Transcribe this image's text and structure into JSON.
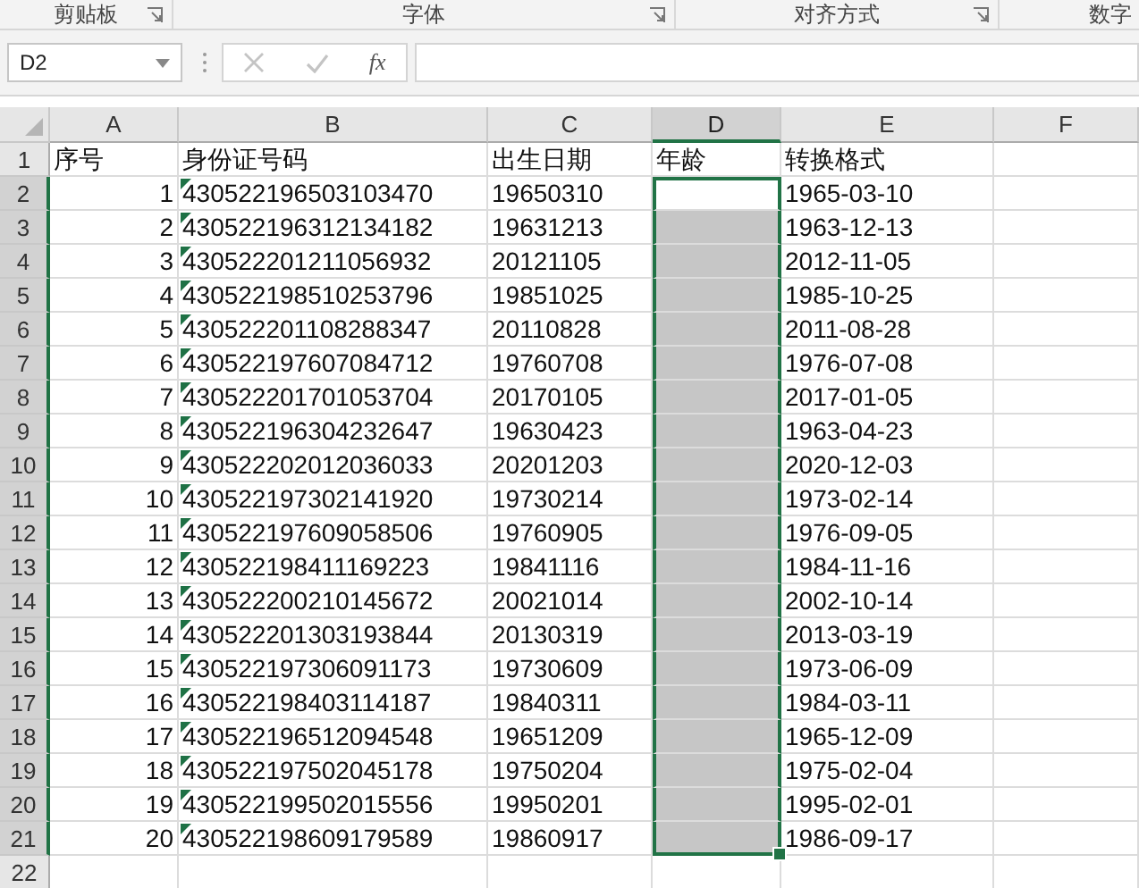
{
  "ribbon_groups": [
    {
      "label": "剪贴板",
      "launcher": true
    },
    {
      "label": "字体",
      "launcher": true
    },
    {
      "label": "对齐方式",
      "launcher": true
    },
    {
      "label": "数字",
      "launcher": false
    }
  ],
  "formula_bar": {
    "name_box": "D2",
    "cancel_disabled": true,
    "enter_disabled": true,
    "fx_label": "fx"
  },
  "columns": [
    {
      "label": "A",
      "selected": false
    },
    {
      "label": "B",
      "selected": false
    },
    {
      "label": "C",
      "selected": false
    },
    {
      "label": "D",
      "selected": true
    },
    {
      "label": "E",
      "selected": false
    },
    {
      "label": "F",
      "selected": false
    }
  ],
  "rows": [
    {
      "number": "1",
      "cells": [
        "序号",
        "身份证号码",
        "出生日期",
        "年龄",
        "转换格式"
      ],
      "selected": false
    },
    {
      "number": "2",
      "cells": [
        "1",
        "430522196503103470",
        "19650310",
        null,
        "1965-03-10"
      ],
      "flagged": true,
      "selected": true,
      "active": true
    },
    {
      "number": "3",
      "cells": [
        "2",
        "430522196312134182",
        "19631213",
        null,
        "1963-12-13"
      ],
      "flagged": true,
      "selected": true
    },
    {
      "number": "4",
      "cells": [
        "3",
        "430522201211056932",
        "20121105",
        null,
        "2012-11-05"
      ],
      "flagged": true,
      "selected": true
    },
    {
      "number": "5",
      "cells": [
        "4",
        "430522198510253796",
        "19851025",
        null,
        "1985-10-25"
      ],
      "flagged": true,
      "selected": true
    },
    {
      "number": "6",
      "cells": [
        "5",
        "430522201108288347",
        "20110828",
        null,
        "2011-08-28"
      ],
      "flagged": true,
      "selected": true
    },
    {
      "number": "7",
      "cells": [
        "6",
        "430522197607084712",
        "19760708",
        null,
        "1976-07-08"
      ],
      "flagged": true,
      "selected": true
    },
    {
      "number": "8",
      "cells": [
        "7",
        "430522201701053704",
        "20170105",
        null,
        "2017-01-05"
      ],
      "flagged": true,
      "selected": true
    },
    {
      "number": "9",
      "cells": [
        "8",
        "430522196304232647",
        "19630423",
        null,
        "1963-04-23"
      ],
      "flagged": true,
      "selected": true
    },
    {
      "number": "10",
      "cells": [
        "9",
        "430522202012036033",
        "20201203",
        null,
        "2020-12-03"
      ],
      "flagged": true,
      "selected": true
    },
    {
      "number": "11",
      "cells": [
        "10",
        "430522197302141920",
        "19730214",
        null,
        "1973-02-14"
      ],
      "flagged": true,
      "selected": true
    },
    {
      "number": "12",
      "cells": [
        "11",
        "430522197609058506",
        "19760905",
        null,
        "1976-09-05"
      ],
      "flagged": true,
      "selected": true
    },
    {
      "number": "13",
      "cells": [
        "12",
        "430522198411169223",
        "19841116",
        null,
        "1984-11-16"
      ],
      "flagged": true,
      "selected": true
    },
    {
      "number": "14",
      "cells": [
        "13",
        "430522200210145672",
        "20021014",
        null,
        "2002-10-14"
      ],
      "flagged": true,
      "selected": true
    },
    {
      "number": "15",
      "cells": [
        "14",
        "430522201303193844",
        "20130319",
        null,
        "2013-03-19"
      ],
      "flagged": true,
      "selected": true
    },
    {
      "number": "16",
      "cells": [
        "15",
        "430522197306091173",
        "19730609",
        null,
        "1973-06-09"
      ],
      "flagged": true,
      "selected": true
    },
    {
      "number": "17",
      "cells": [
        "16",
        "430522198403114187",
        "19840311",
        null,
        "1984-03-11"
      ],
      "flagged": true,
      "selected": true
    },
    {
      "number": "18",
      "cells": [
        "17",
        "430522196512094548",
        "19651209",
        null,
        "1965-12-09"
      ],
      "flagged": true,
      "selected": true
    },
    {
      "number": "19",
      "cells": [
        "18",
        "430522197502045178",
        "19750204",
        null,
        "1975-02-04"
      ],
      "flagged": true,
      "selected": true
    },
    {
      "number": "20",
      "cells": [
        "19",
        "430522199502015556",
        "19950201",
        null,
        "1995-02-01"
      ],
      "flagged": true,
      "selected": true
    },
    {
      "number": "21",
      "cells": [
        "20",
        "430522198609179589",
        "19860917",
        null,
        "1986-09-17"
      ],
      "flagged": true,
      "selected": true
    },
    {
      "number": "22",
      "cells": [],
      "selected": false
    }
  ]
}
